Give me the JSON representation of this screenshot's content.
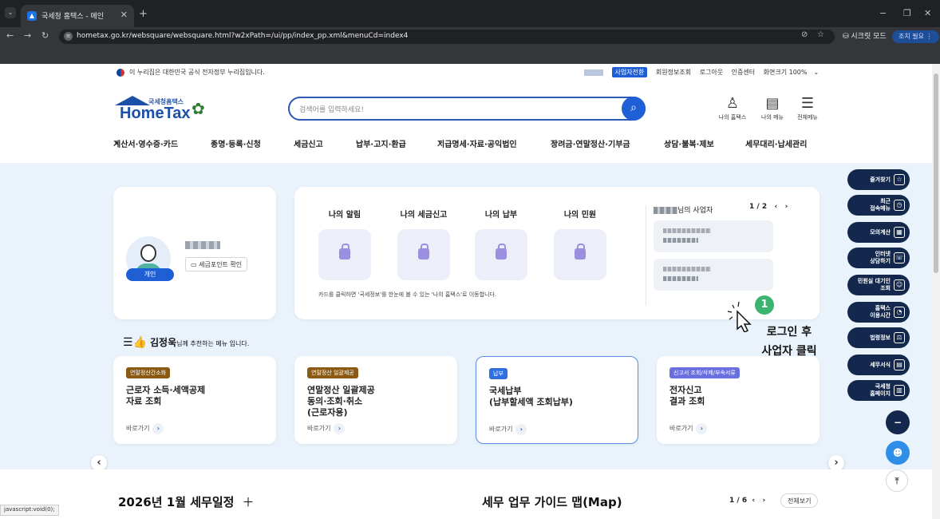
{
  "browser": {
    "tab_title": "국세청 홈택스 - 메인",
    "url": "hometax.go.kr/websquare/websquare.html?w2xPath=/ui/pp/index_pp.xml&menuCd=index4",
    "incognito_label": "시크릿 모드",
    "sync_label": "조치 필요",
    "status_url": "javascript:void(0);"
  },
  "gov": {
    "notice": "이 누리집은 대한민국 공식 전자정부 누리집입니다."
  },
  "top_links": {
    "biz_switch": "사업자전환",
    "member_info": "회원정보조회",
    "logout": "로그아웃",
    "cert_center": "인증센터",
    "font_size": "화면크기 100%"
  },
  "logo": {
    "small": "국세청홈택스",
    "big": "HomeTax"
  },
  "search": {
    "placeholder": "검색어를 입력하세요!"
  },
  "header_icons": {
    "my_hometax": "나의 홈택스",
    "my_menu": "나의 메뉴",
    "all_menu": "전체메뉴"
  },
  "gnb": [
    "계산서·영수증·카드",
    "증명·등록·신청",
    "세금신고",
    "납부·고지·환급",
    "지급명세·자료·공익법인",
    "장려금·연말정산·기부금",
    "상담·불복·제보",
    "세무대리·납세관리"
  ],
  "profile": {
    "badge": "개인",
    "point_button": "세금포인트 확인"
  },
  "my": {
    "items": [
      "나의 알림",
      "나의 세금신고",
      "나의 납부",
      "나의 민원"
    ],
    "note": "카드를 클릭하면 '국세정보'를 한눈에 볼 수 있는 '나의 홈택스'로 이동합니다.",
    "biz_title_suffix": "님의 사업자",
    "biz_pager": "1 / 2"
  },
  "annotation": {
    "number": "1",
    "text": "로그인 후\n사업자 클릭"
  },
  "recommend": {
    "name": "김정욱",
    "suffix": "님께 추천하는 메뉴 입니다.",
    "go_label": "바로가기",
    "cards": [
      {
        "tag": "연말정산간소화",
        "tag_color": "#8a5a14",
        "text": "근로자 소득·세액공제\n자료 조회"
      },
      {
        "tag": "연말정산 일괄제공",
        "tag_color": "#8a5a14",
        "text": "연말정산 일괄제공\n동의·조회·취소\n(근로자용)"
      },
      {
        "tag": "납부",
        "tag_color": "#2f6fe0",
        "text": "국세납부\n(납부할세액 조회납부)"
      },
      {
        "tag": "신고서 조회/삭제/부속서류",
        "tag_color": "#6a6fe0",
        "text": "전자신고\n결과 조회"
      }
    ]
  },
  "quick_menu": [
    {
      "label": "즐겨찾기",
      "icon": "star-icon",
      "glyph": "☆"
    },
    {
      "label": "최근\n접속메뉴",
      "icon": "clock-icon",
      "glyph": "◷"
    },
    {
      "label": "모의계산",
      "icon": "calculator-icon",
      "glyph": "▦"
    },
    {
      "label": "인터넷\n상담하기",
      "icon": "chat-icon",
      "glyph": "☏"
    },
    {
      "label": "민원실 대기인\n조회",
      "icon": "person-icon",
      "glyph": "☺"
    },
    {
      "label": "홈택스\n이용시간",
      "icon": "time-icon",
      "glyph": "◔"
    },
    {
      "label": "법령정보",
      "icon": "law-icon",
      "glyph": "⚖"
    },
    {
      "label": "세무서식",
      "icon": "form-icon",
      "glyph": "▤"
    },
    {
      "label": "국세청\n홈페이지",
      "icon": "home-icon",
      "glyph": "▥"
    }
  ],
  "bottom": {
    "schedule": "2026년 1월 세무일정",
    "guide": "세무 업무 가이드 맵(Map)",
    "guide_pager": "1 / 6",
    "view_all": "전체보기"
  },
  "colors": {
    "brand": "#1e5fd6",
    "navy": "#13284c",
    "bg": "#eaf3fb",
    "annotation": "#3cb371"
  }
}
